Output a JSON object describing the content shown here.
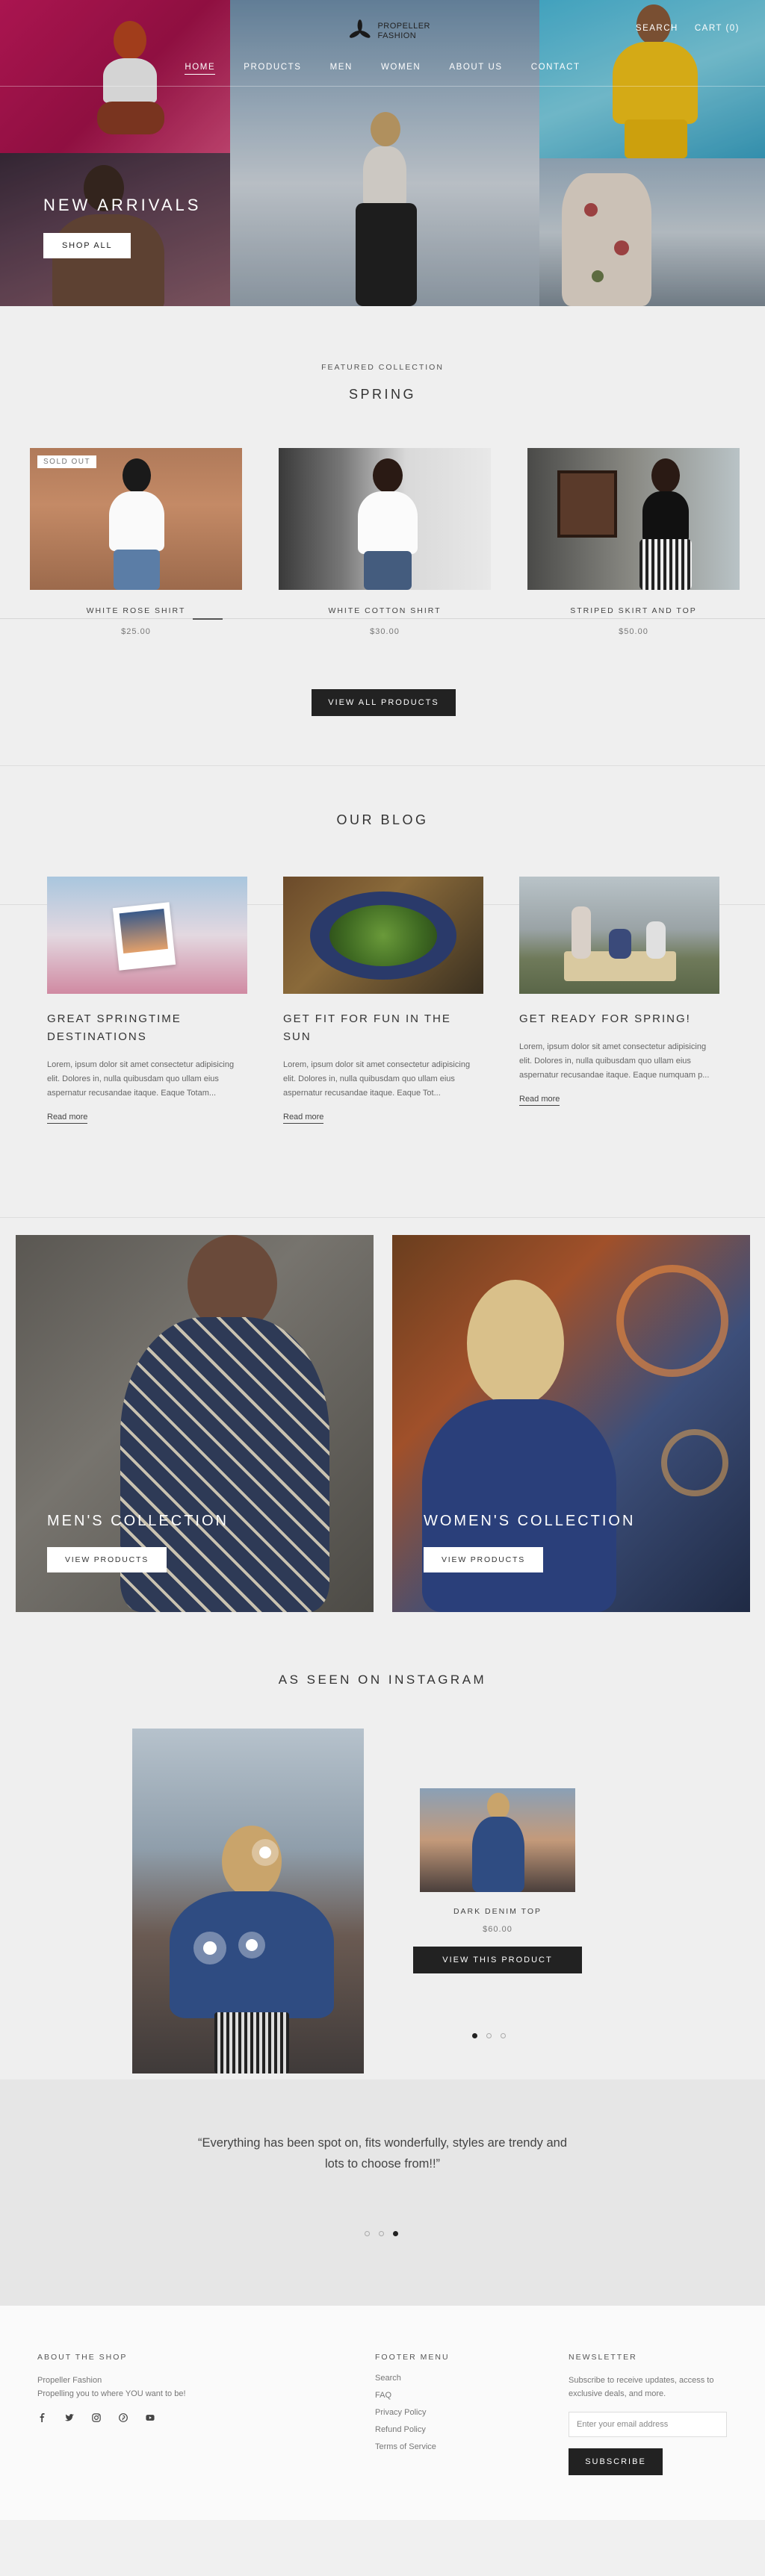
{
  "brand": {
    "name_line1": "PROPELLER",
    "name_line2": "FASHION"
  },
  "nav": {
    "items": [
      "HOME",
      "PRODUCTS",
      "MEN",
      "WOMEN",
      "ABOUT US",
      "CONTACT"
    ],
    "search_label": "SEARCH",
    "cart_label": "CART (0)"
  },
  "hero": {
    "title": "NEW ARRIVALS",
    "button_label": "SHOP ALL"
  },
  "featured": {
    "subtitle": "FEATURED COLLECTION",
    "title": "SPRING",
    "products": [
      {
        "name": "WHITE ROSE SHIRT",
        "price": "$25.00",
        "badge": "SOLD OUT"
      },
      {
        "name": "WHITE COTTON SHIRT",
        "price": "$30.00"
      },
      {
        "name": "STRIPED SKIRT AND TOP",
        "price": "$50.00"
      }
    ],
    "view_all_label": "VIEW ALL PRODUCTS"
  },
  "blog": {
    "title": "OUR BLOG",
    "posts": [
      {
        "title": "GREAT SPRINGTIME DESTINATIONS",
        "excerpt": "Lorem, ipsum dolor sit amet consectetur adipisicing elit. Dolores in, nulla quibusdam quo ullam eius aspernatur recusandae itaque. Eaque Totam...",
        "more_label": "Read more"
      },
      {
        "title": "GET FIT FOR FUN IN THE SUN",
        "excerpt": "Lorem, ipsum dolor sit amet consectetur adipisicing elit. Dolores in, nulla quibusdam quo ullam eius aspernatur recusandae itaque. Eaque Tot...",
        "more_label": "Read more"
      },
      {
        "title": "GET READY FOR SPRING!",
        "excerpt": "Lorem, ipsum dolor sit amet consectetur adipisicing elit. Dolores in, nulla quibusdam quo ullam eius aspernatur recusandae itaque. Eaque numquam p...",
        "more_label": "Read more"
      }
    ]
  },
  "collections": {
    "men": {
      "title": "MEN'S COLLECTION",
      "button_label": "VIEW PRODUCTS"
    },
    "women": {
      "title": "WOMEN'S COLLECTION",
      "button_label": "VIEW PRODUCTS"
    }
  },
  "instagram": {
    "title": "AS SEEN ON INSTAGRAM",
    "product": {
      "name": "DARK DENIM TOP",
      "price": "$60.00",
      "button_label": "VIEW THIS PRODUCT"
    }
  },
  "testimonial": {
    "quote": "“Everything has been spot on, fits wonderfully, styles are trendy and lots to choose from!!”"
  },
  "footer": {
    "about": {
      "heading": "ABOUT THE SHOP",
      "line1": "Propeller Fashion",
      "line2": "Propelling you to where YOU want to be!"
    },
    "menu": {
      "heading": "FOOTER MENU",
      "links": [
        "Search",
        "FAQ",
        "Privacy Policy",
        "Refund Policy",
        "Terms of Service"
      ]
    },
    "newsletter": {
      "heading": "NEWSLETTER",
      "text": "Subscribe to receive updates, access to exclusive deals, and more.",
      "placeholder": "Enter your email address",
      "button_label": "SUBSCRIBE"
    },
    "socials": [
      "facebook-icon",
      "twitter-icon",
      "instagram-icon",
      "pinterest-icon",
      "youtube-icon"
    ]
  },
  "colors": {
    "accent": "#222222",
    "hero_pink": "#c2185b",
    "hero_cyan": "#4bb8d8",
    "background": "#efefef"
  }
}
